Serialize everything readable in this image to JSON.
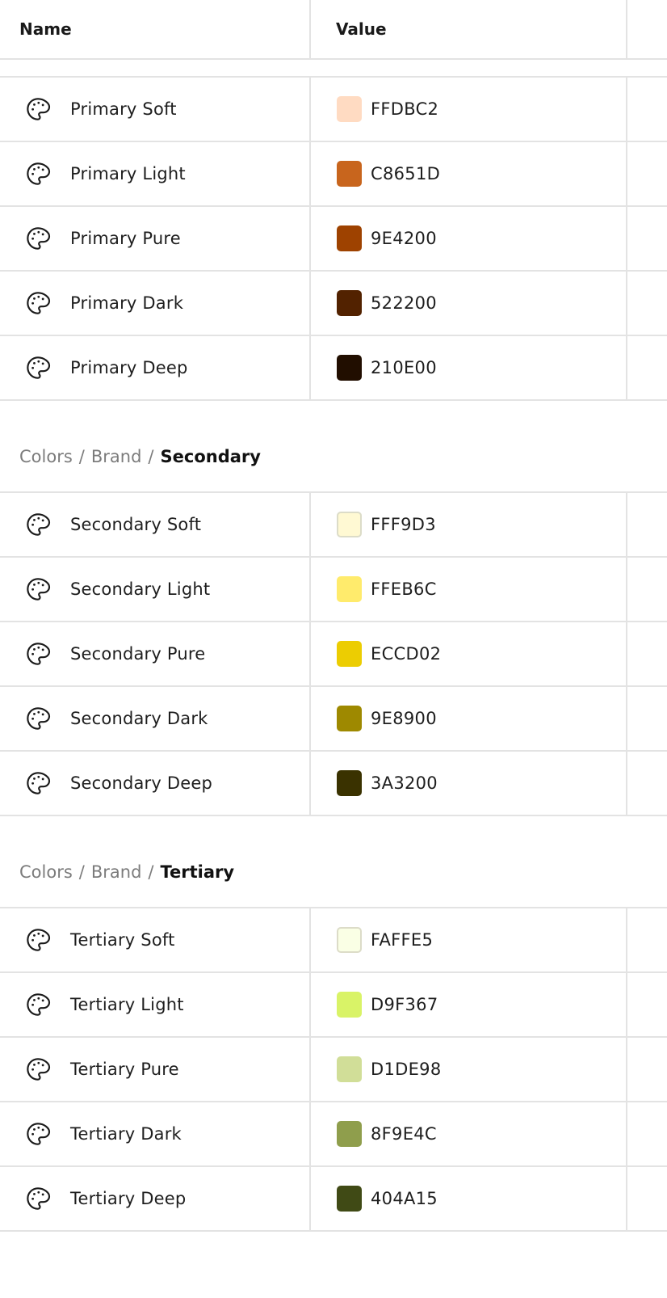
{
  "header": {
    "name_label": "Name",
    "value_label": "Value"
  },
  "sections": [
    {
      "breadcrumb": null,
      "rows": [
        {
          "name": "Primary Soft",
          "value": "FFDBC2",
          "color": "#FFDBC2"
        },
        {
          "name": "Primary Light",
          "value": "C8651D",
          "color": "#C8651D"
        },
        {
          "name": "Primary Pure",
          "value": "9E4200",
          "color": "#9E4200"
        },
        {
          "name": "Primary Dark",
          "value": "522200",
          "color": "#522200"
        },
        {
          "name": "Primary Deep",
          "value": "210E00",
          "color": "#210E00"
        }
      ]
    },
    {
      "breadcrumb": {
        "parts": [
          "Colors",
          "Brand"
        ],
        "separator": "/",
        "current": "Secondary"
      },
      "rows": [
        {
          "name": "Secondary Soft",
          "value": "FFF9D3",
          "color": "#FFF9D3"
        },
        {
          "name": "Secondary Light",
          "value": "FFEB6C",
          "color": "#FFEB6C"
        },
        {
          "name": "Secondary Pure",
          "value": "ECCD02",
          "color": "#ECCD02"
        },
        {
          "name": "Secondary Dark",
          "value": "9E8900",
          "color": "#9E8900"
        },
        {
          "name": "Secondary Deep",
          "value": "3A3200",
          "color": "#3A3200"
        }
      ]
    },
    {
      "breadcrumb": {
        "parts": [
          "Colors",
          "Brand"
        ],
        "separator": "/",
        "current": "Tertiary"
      },
      "rows": [
        {
          "name": "Tertiary Soft",
          "value": "FAFFE5",
          "color": "#FAFFE5"
        },
        {
          "name": "Tertiary Light",
          "value": "D9F367",
          "color": "#D9F367"
        },
        {
          "name": "Tertiary Pure",
          "value": "D1DE98",
          "color": "#D1DE98"
        },
        {
          "name": "Tertiary Dark",
          "value": "8F9E4C",
          "color": "#8F9E4C"
        },
        {
          "name": "Tertiary Deep",
          "value": "404A15",
          "color": "#404A15"
        }
      ]
    }
  ],
  "icons": {
    "row_icon": "palette-icon"
  }
}
